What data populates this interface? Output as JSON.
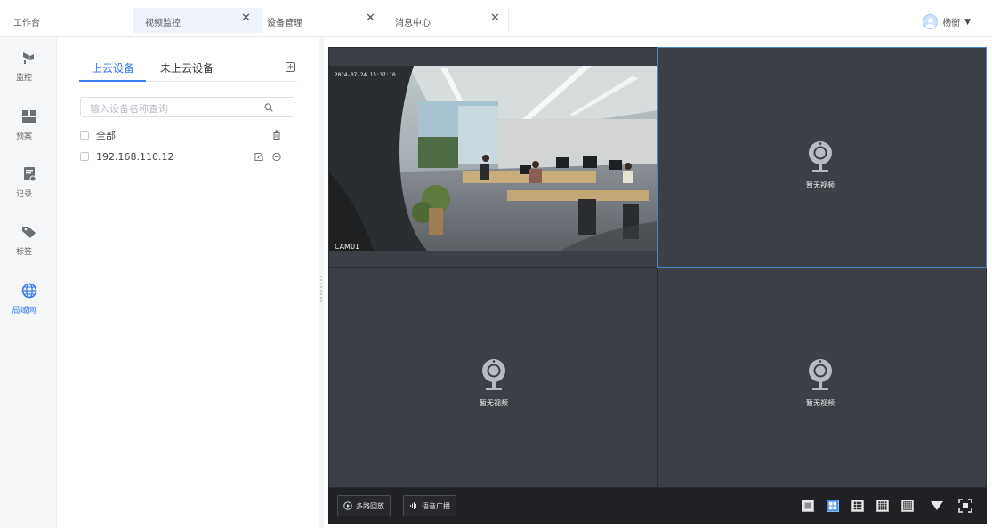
{
  "tabs": {
    "workbench": "工作台",
    "video": "视频监控",
    "device": "设备管理",
    "message": "消息中心",
    "close_glyph": "✕"
  },
  "user": {
    "name": "杨衡"
  },
  "rail": [
    {
      "label": "监控",
      "icon": "camera-icon"
    },
    {
      "label": "预案",
      "icon": "plan-icon"
    },
    {
      "label": "记录",
      "icon": "record-icon"
    },
    {
      "label": "标签",
      "icon": "tag-icon"
    },
    {
      "label": "局域网",
      "icon": "globe-icon"
    }
  ],
  "panel": {
    "tab_cloud": "上云设备",
    "tab_local": "未上云设备",
    "search_placeholder": "输入设备名称查询",
    "select_all": "全部",
    "devices": [
      {
        "ip": "192.168.110.12"
      }
    ]
  },
  "video": {
    "timestamp": "2024-07-24 15:37:10",
    "camera_name": "CAM01",
    "no_video": "暂无视频"
  },
  "toolbar": {
    "playback": "多路回放",
    "broadcast": "语音广播"
  },
  "layout_buttons": [
    {
      "name": "layout-1",
      "selected": false
    },
    {
      "name": "layout-4",
      "selected": true
    },
    {
      "name": "layout-9",
      "selected": false
    },
    {
      "name": "layout-16",
      "selected": false
    },
    {
      "name": "layout-25",
      "selected": false
    }
  ],
  "colors": {
    "accent": "#3a7cf0",
    "video_bg": "#3c3f45",
    "toolbar_bg": "#1f2124"
  }
}
